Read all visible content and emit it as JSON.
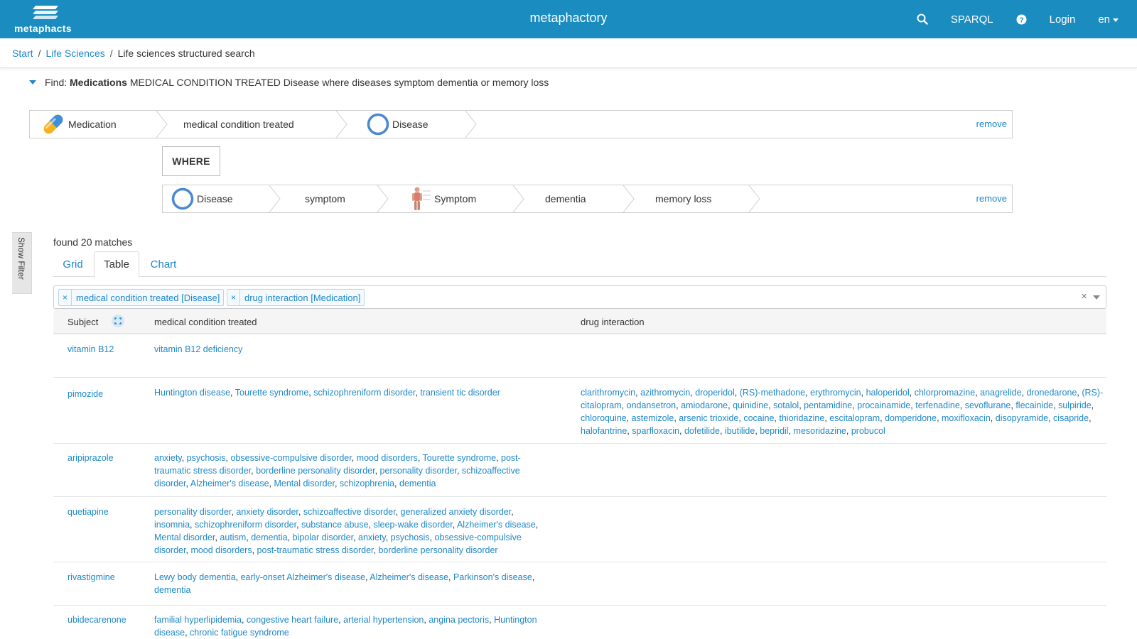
{
  "header": {
    "logo_text": "metaphacts",
    "app_title": "metaphactory",
    "nav": {
      "sparql": "SPARQL",
      "login": "Login",
      "language": "en"
    }
  },
  "breadcrumb": {
    "items": [
      "Start",
      "Life Sciences"
    ],
    "separator": "/",
    "current": "Life sciences structured search"
  },
  "query": {
    "find_label": "Find:",
    "find_bold": "Medications",
    "find_rest": "MEDICAL CONDITION TREATED Disease where diseases symptom dementia or memory loss",
    "row1": {
      "segments": [
        "Medication",
        "medical condition treated",
        "Disease"
      ],
      "remove": "remove"
    },
    "where": "WHERE",
    "row2": {
      "segments": [
        "Disease",
        "symptom",
        "Symptom",
        "dementia",
        "memory loss"
      ],
      "remove": "remove"
    }
  },
  "sidebar": {
    "show_filter": "Show Filter"
  },
  "results": {
    "found": "found 20 matches",
    "tabs": [
      "Grid",
      "Table",
      "Chart"
    ],
    "active_tab": "Table",
    "chips": [
      "medical condition treated [Disease]",
      "drug interaction [Medication]"
    ],
    "columns": [
      "Subject",
      "medical condition treated",
      "drug interaction"
    ],
    "rows": [
      {
        "subject": "vitamin B12",
        "conditions": [
          "vitamin B12 deficiency"
        ],
        "interactions": []
      },
      {
        "subject": "pimozide",
        "conditions": [
          "Huntington disease",
          "Tourette syndrome",
          "schizophreniform disorder",
          "transient tic disorder"
        ],
        "interactions": [
          "clarithromycin",
          "azithromycin",
          "droperidol",
          "(RS)-methadone",
          "erythromycin",
          "haloperidol",
          "chlorpromazine",
          "anagrelide",
          "dronedarone",
          "(RS)-citalopram",
          "ondansetron",
          "amiodarone",
          "quinidine",
          "sotalol",
          "pentamidine",
          "procainamide",
          "terfenadine",
          "sevoflurane",
          "flecainide",
          "sulpiride",
          "chloroquine",
          "astemizole",
          "arsenic trioxide",
          "cocaine",
          "thioridazine",
          "escitalopram",
          "domperidone",
          "moxifloxacin",
          "disopyramide",
          "cisapride",
          "halofantrine",
          "sparfloxacin",
          "dofetilide",
          "ibutilide",
          "bepridil",
          "mesoridazine",
          "probucol"
        ]
      },
      {
        "subject": "aripiprazole",
        "conditions": [
          "anxiety",
          "psychosis",
          "obsessive-compulsive disorder",
          "mood disorders",
          "Tourette syndrome",
          "post-traumatic stress disorder",
          "borderline personality disorder",
          "personality disorder",
          "schizoaffective disorder",
          "Alzheimer's disease",
          "Mental disorder",
          "schizophrenia",
          "dementia"
        ],
        "interactions": []
      },
      {
        "subject": "quetiapine",
        "conditions": [
          "personality disorder",
          "anxiety disorder",
          "schizoaffective disorder",
          "generalized anxiety disorder",
          "insomnia",
          "schizophreniform disorder",
          "substance abuse",
          "sleep-wake disorder",
          "Alzheimer's disease",
          "Mental disorder",
          "autism",
          "dementia",
          "bipolar disorder",
          "anxiety",
          "psychosis",
          "obsessive-compulsive disorder",
          "mood disorders",
          "post-traumatic stress disorder",
          "borderline personality disorder"
        ],
        "interactions": []
      },
      {
        "subject": "rivastigmine",
        "conditions": [
          "Lewy body dementia",
          "early-onset Alzheimer's disease",
          "Alzheimer's disease",
          "Parkinson's disease",
          "dementia"
        ],
        "interactions": []
      },
      {
        "subject": "ubidecarenone",
        "conditions": [
          "familial hyperlipidemia",
          "congestive heart failure",
          "arterial hypertension",
          "angina pectoris",
          "Huntington disease",
          "chronic fatigue syndrome"
        ],
        "interactions": []
      }
    ]
  },
  "colors": {
    "primary": "#1a8cc0",
    "link": "#1e88c7"
  }
}
